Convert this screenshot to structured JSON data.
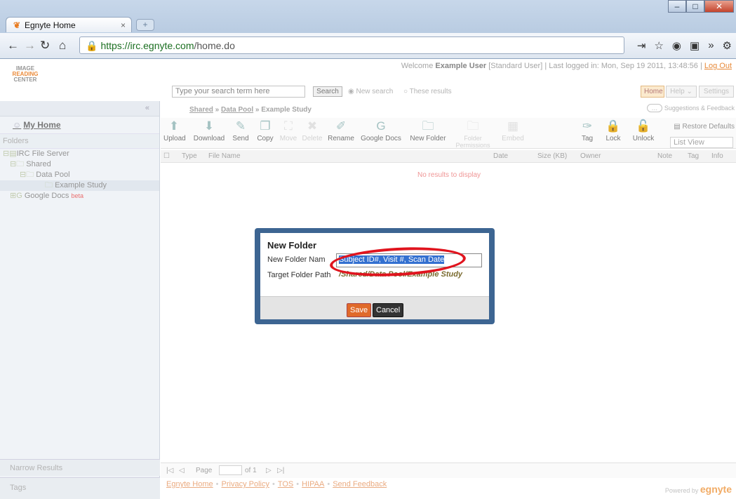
{
  "browser": {
    "tab_title": "Egnyte Home",
    "url_host": "https://irc.egnyte.com",
    "url_path": "/home.do"
  },
  "header": {
    "logo": [
      "IMAGE",
      "READING",
      "CENTER"
    ],
    "welcome_prefix": "Welcome",
    "user": "Example User",
    "role": "[Standard User]",
    "last_logged": "| Last logged in: Mon, Sep 19 2011, 13:48:56 |",
    "logout": "Log Out",
    "search_placeholder": "Type your search term here",
    "search_button": "Search",
    "radio_new": "New search",
    "radio_these": "These results",
    "nav": {
      "home": "Home",
      "help": "Help",
      "settings": "Settings"
    }
  },
  "sidebar": {
    "my_home": "My Home",
    "folders_header": "Folders",
    "tree": [
      "IRC File Server",
      "Shared",
      "Data Pool",
      "Example Study",
      "Google Docs"
    ],
    "beta": "beta",
    "narrow": "Narrow Results",
    "tags": "Tags"
  },
  "main": {
    "breadcrumb": [
      "Shared",
      "Data Pool",
      "Example Study"
    ],
    "feedback": "Suggestions & Feedback",
    "restore": "Restore Defaults",
    "list_view": "List View",
    "toolbar": [
      "Upload",
      "Download",
      "Send",
      "Copy",
      "Move",
      "Delete",
      "Rename",
      "Google Docs",
      "New Folder",
      "Folder Permissions",
      "Embed",
      "Tag",
      "Lock",
      "Unlock"
    ],
    "columns": [
      "Type",
      "File Name",
      "Date",
      "Size (KB)",
      "Owner",
      "Note",
      "Tag",
      "Info"
    ],
    "no_results": "No results to display",
    "pager_page": "Page",
    "pager_of": "of 1"
  },
  "footer": {
    "links": [
      "Egnyte Home",
      "Privacy Policy",
      "TOS",
      "HIPAA",
      "Send Feedback"
    ],
    "powered_by": "Powered by",
    "brand": "egnyte"
  },
  "dialog": {
    "title": "New Folder",
    "name_label": "New Folder Nam",
    "name_value": "Subject ID#, Visit #, Scan Date",
    "path_label": "Target Folder Path",
    "path_value": "/Shared/Data Pool/Example Study",
    "save": "Save",
    "cancel": "Cancel"
  }
}
